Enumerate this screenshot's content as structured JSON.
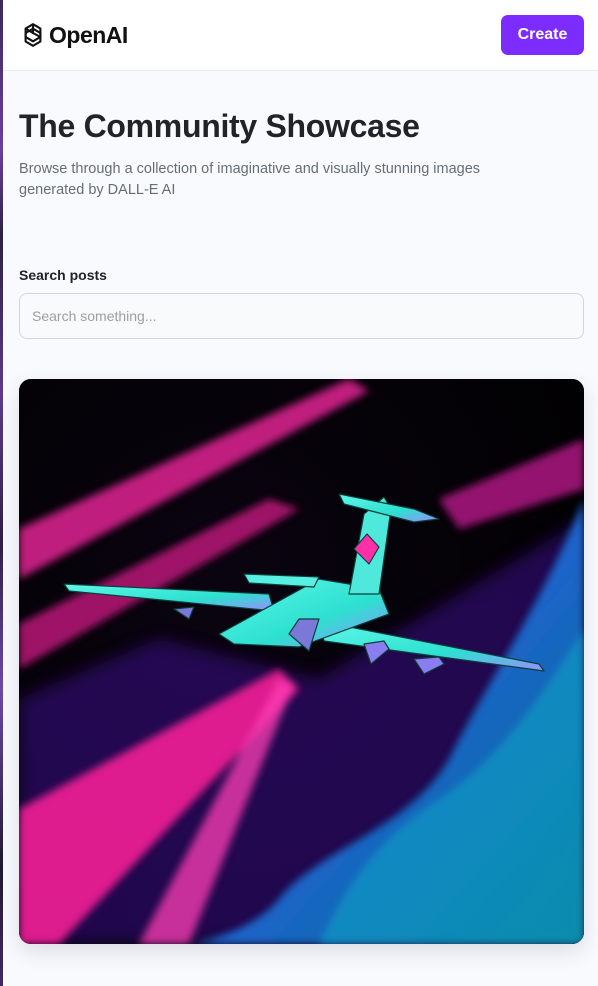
{
  "header": {
    "logo_text": "OpenAI",
    "logo_icon": "openai-logo-icon",
    "create_label": "Create"
  },
  "hero": {
    "title": "The Community Showcase",
    "subtitle": "Browse through a collection of imaginative and visually stunning images generated by DALL-E AI"
  },
  "search": {
    "label": "Search posts",
    "value": "",
    "placeholder": "Search something..."
  },
  "colors": {
    "accent": "#7c2cff",
    "background": "#f9fafe",
    "title": "#222328",
    "muted": "#666e75"
  }
}
